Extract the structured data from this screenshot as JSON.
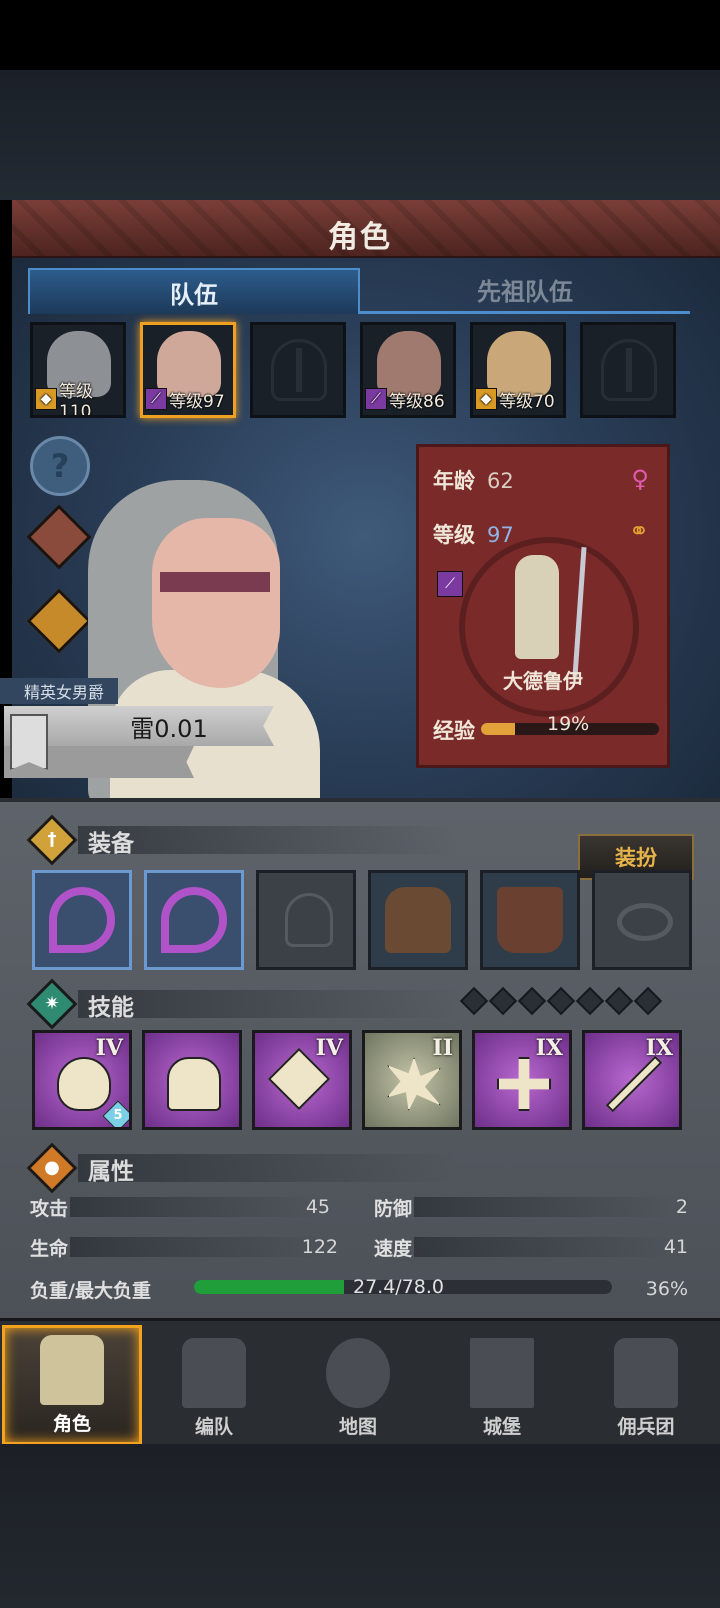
{
  "header": {
    "title": "角色"
  },
  "tabs": [
    {
      "label": "队伍",
      "active": true
    },
    {
      "label": "先祖队伍",
      "active": false
    }
  ],
  "roster": [
    {
      "level": "等级110",
      "class_badge": "shield",
      "badge_color": "#d89a25",
      "empty": false,
      "selected": false
    },
    {
      "level": "等级97",
      "class_badge": "staff",
      "badge_color": "#7a3aa0",
      "empty": false,
      "selected": true
    },
    {
      "level": "",
      "empty": true
    },
    {
      "level": "等级86",
      "class_badge": "staff",
      "badge_color": "#7a3aa0",
      "empty": false,
      "selected": false
    },
    {
      "level": "等级70",
      "class_badge": "shield",
      "badge_color": "#d89a25",
      "empty": false,
      "selected": false
    },
    {
      "level": "",
      "empty": true
    }
  ],
  "hero": {
    "rank": "精英女男爵",
    "name": "雷0.01"
  },
  "info_card": {
    "age_label": "年龄",
    "age": "62",
    "level_label": "等级",
    "level": "97",
    "class_name": "大德鲁伊",
    "exp_label": "经验",
    "exp_percent_text": "19%",
    "exp_fraction": 0.19,
    "gender_icon": "female-icon"
  },
  "equipment": {
    "title": "装备",
    "dress_button": "装扮",
    "slots": [
      "weapon",
      "weapon",
      "helmet-empty",
      "armor",
      "boots",
      "ring-empty"
    ]
  },
  "skills": {
    "title": "技能",
    "items": [
      {
        "rank": "IV",
        "count": "5",
        "color": "purple"
      },
      {
        "rank": "",
        "count": "",
        "color": "purple"
      },
      {
        "rank": "IV",
        "count": "",
        "color": "purple"
      },
      {
        "rank": "II",
        "count": "",
        "color": "gray"
      },
      {
        "rank": "IX",
        "count": "",
        "color": "purple"
      },
      {
        "rank": "IX",
        "count": "",
        "color": "purple"
      }
    ],
    "pips": 7
  },
  "attributes": {
    "title": "属性",
    "attack_label": "攻击",
    "attack": "45",
    "defense_label": "防御",
    "defense": "2",
    "hp_label": "生命",
    "hp": "122",
    "speed_label": "速度",
    "speed": "41",
    "load_label": "负重/最大负重",
    "load_text": "27.4/78.0",
    "load_percent_text": "36%",
    "load_fraction": 0.36
  },
  "nav": [
    {
      "label": "角色",
      "active": true
    },
    {
      "label": "编队",
      "active": false
    },
    {
      "label": "地图",
      "active": false
    },
    {
      "label": "城堡",
      "active": false
    },
    {
      "label": "佣兵团",
      "active": false
    }
  ]
}
